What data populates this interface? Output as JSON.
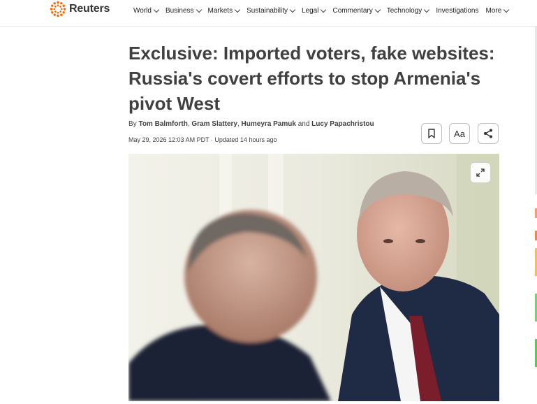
{
  "brand": {
    "name": "Reuters",
    "accent": "#fa6400"
  },
  "nav": {
    "items": [
      {
        "label": "World",
        "has_menu": true
      },
      {
        "label": "Business",
        "has_menu": true
      },
      {
        "label": "Markets",
        "has_menu": true
      },
      {
        "label": "Sustainability",
        "has_menu": true
      },
      {
        "label": "Legal",
        "has_menu": true
      },
      {
        "label": "Commentary",
        "has_menu": true
      },
      {
        "label": "Technology",
        "has_menu": true
      },
      {
        "label": "Investigations",
        "has_menu": false
      },
      {
        "label": "More",
        "has_menu": true
      }
    ]
  },
  "article": {
    "headline": "Exclusive: Imported voters, fake websites: Russia's covert efforts to stop Armenia's pivot West",
    "byline": {
      "prefix": "By",
      "authors": [
        "Tom Balmforth",
        "Gram Slattery",
        "Humeyra Pamuk",
        "Lucy Papachristou"
      ],
      "sep1": ", ",
      "sep2": ", ",
      "and": " and "
    },
    "dateline": "May 29, 2026 12:03 AM PDT · Updated 14 hours ago",
    "tools": {
      "bookmark_icon": "bookmark-icon",
      "text_size_label": "Aa",
      "share_icon": "share-icon"
    },
    "photo": {
      "expand_icon": "expand-icon"
    }
  }
}
